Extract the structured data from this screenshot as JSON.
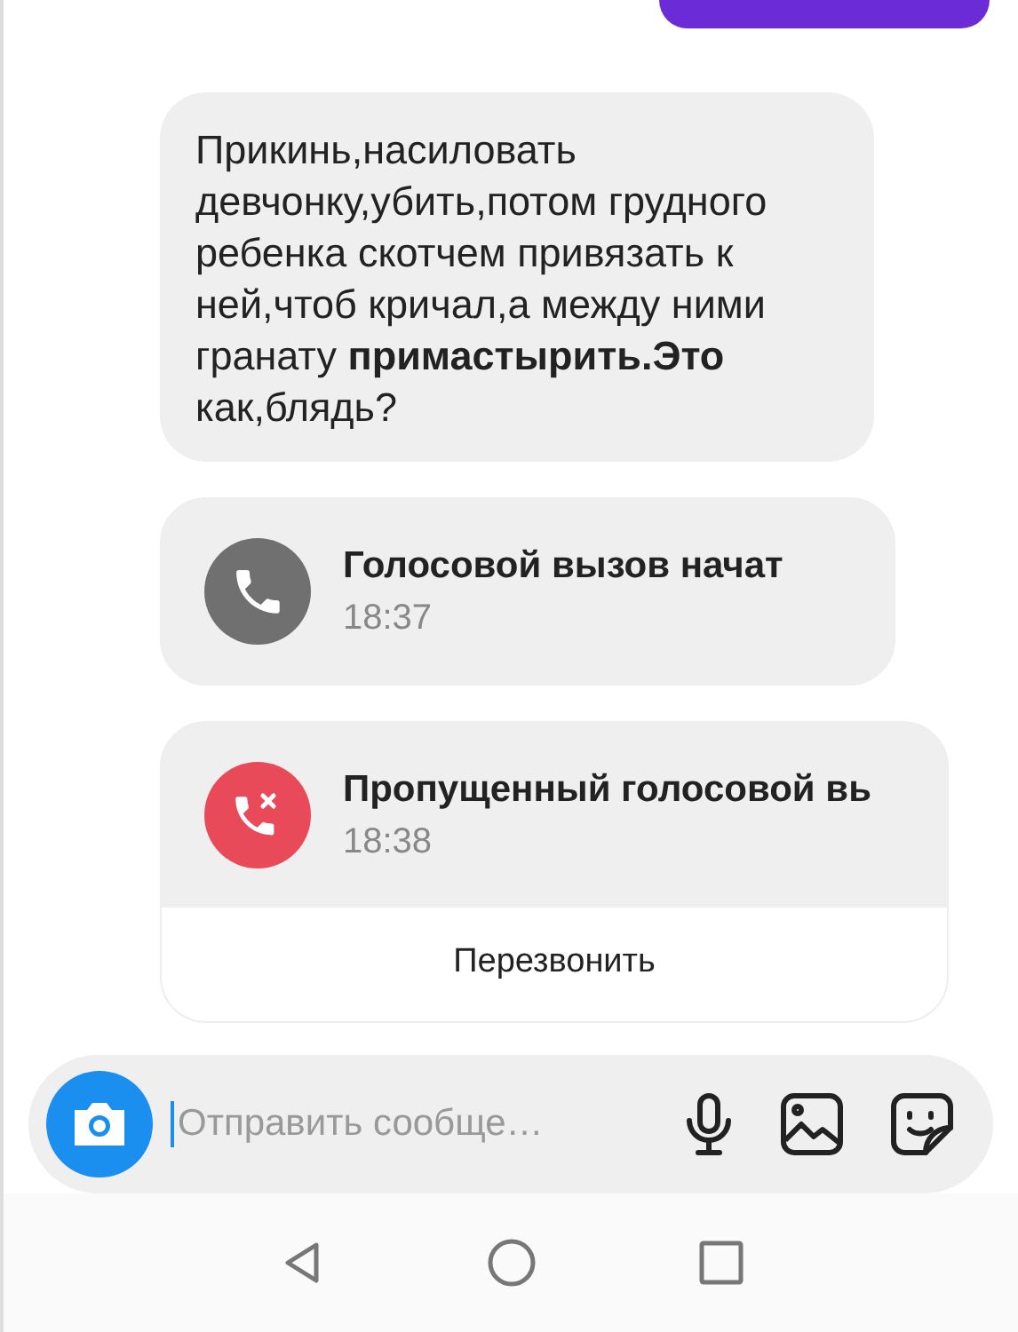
{
  "messages": [
    {
      "kind": "outgoing_cut"
    },
    {
      "kind": "text",
      "text": "Прикинь,насиловать девчонку,убить,потом грудного ребенка скотчем привязать к ней,чтоб кричал,а между ними гранату **примастырить.Это** как,блядь?"
    },
    {
      "kind": "call_started",
      "title": "Голосовой вызов начат",
      "time": "18:37"
    },
    {
      "kind": "call_missed",
      "title": "Пропущенный голосовой вь",
      "time": "18:38",
      "action": "Перезвонить"
    }
  ],
  "composer": {
    "placeholder": "Отправить сообще…"
  },
  "nav_bar": [
    {
      "kind": "back"
    },
    {
      "kind": "home"
    },
    {
      "kind": "recents"
    }
  ]
}
